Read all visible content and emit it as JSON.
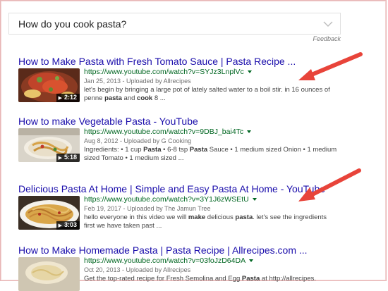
{
  "question": {
    "text": "How do you cook pasta?",
    "expand_icon": "chevron-down-icon"
  },
  "feedback_label": "Feedback",
  "results": [
    {
      "title": "How to Make Pasta with Fresh Tomato Sauce | Pasta Recipe ...",
      "url": "https://www.youtube.com/watch?v=SYJz3LnplVc",
      "date": "Jan 25, 2013 - Uploaded by Allrecipes",
      "snippet_parts": [
        {
          "t": "let's begin by bringing a large pot of lately salted water to a boil stir. in 16 ounces of penne ",
          "b": false
        },
        {
          "t": "pasta",
          "b": true
        },
        {
          "t": " and ",
          "b": false
        },
        {
          "t": "cook",
          "b": true
        },
        {
          "t": " 8 ...",
          "b": false
        }
      ],
      "duration": "2:12"
    },
    {
      "title": "How to make Vegetable Pasta - YouTube",
      "url": "https://www.youtube.com/watch?v=9DBJ_bai4Tc",
      "date": "Aug 8, 2012 - Uploaded by G Cooking",
      "snippet_parts": [
        {
          "t": "Ingredients: • 1 cup ",
          "b": false
        },
        {
          "t": "Pasta",
          "b": true
        },
        {
          "t": " • 6-8 tsp ",
          "b": false
        },
        {
          "t": "Pasta",
          "b": true
        },
        {
          "t": " Sauce • 1 medium sized Onion • 1 medium sized Tomato • 1 medium sized ...",
          "b": false
        }
      ],
      "duration": "5:18"
    },
    {
      "title": "Delicious Pasta At Home | Simple and Easy Pasta At Home - YouTube",
      "url": "https://www.youtube.com/watch?v=3Y1J6zWSEtU",
      "date": "Feb 19, 2017 - Uploaded by The Jamun Tree",
      "snippet_parts": [
        {
          "t": "hello everyone in this video we will ",
          "b": false
        },
        {
          "t": "make",
          "b": true
        },
        {
          "t": " delicious ",
          "b": false
        },
        {
          "t": "pasta",
          "b": true
        },
        {
          "t": ". let's see the ingredients first we have taken past ...",
          "b": false
        }
      ],
      "duration": "3:03"
    },
    {
      "title": "How to Make Homemade Pasta | Pasta Recipe | Allrecipes.com ...",
      "url": "https://www.youtube.com/watch?v=03foJzD64DA",
      "date": "Oct 20, 2013 - Uploaded by Allrecipes",
      "snippet_parts": [
        {
          "t": "Get the top-rated recipe for Fresh Semolina and Egg ",
          "b": false
        },
        {
          "t": "Pasta",
          "b": true
        },
        {
          "t": " at http://allrecipes.",
          "b": false
        }
      ],
      "duration": ""
    }
  ],
  "annotation_arrows": [
    "red-arrow",
    "red-arrow"
  ],
  "colors": {
    "title_link": "#1a0dab",
    "url": "#006621",
    "date": "#707070",
    "snippet": "#444444",
    "arrow": "#e8443a"
  }
}
